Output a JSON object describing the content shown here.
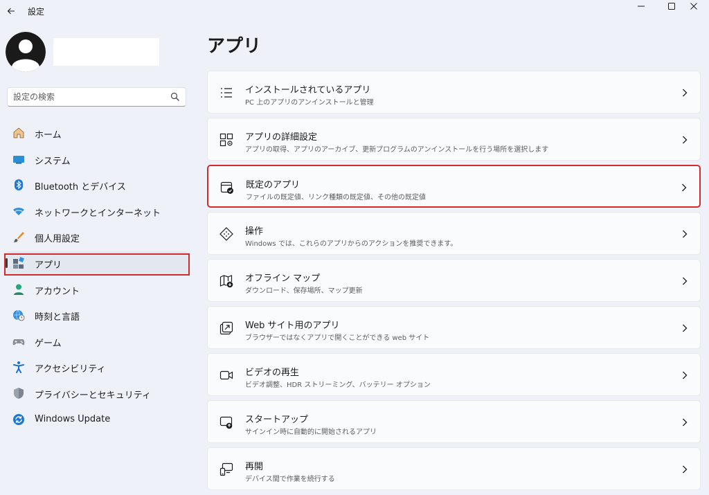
{
  "titlebar": {
    "title": "設定",
    "back_icon": "arrow-left-icon",
    "controls": [
      "minimize-icon",
      "maximize-icon",
      "close-icon"
    ]
  },
  "user": {
    "avatar_icon": "person-avatar-icon"
  },
  "search": {
    "placeholder": "設定の検索",
    "icon": "search-icon"
  },
  "sidebar": {
    "items": [
      {
        "label": "ホーム",
        "icon": "home-icon",
        "active": false
      },
      {
        "label": "システム",
        "icon": "monitor-icon",
        "active": false
      },
      {
        "label": "Bluetooth とデバイス",
        "icon": "bluetooth-icon",
        "active": false
      },
      {
        "label": "ネットワークとインターネット",
        "icon": "wifi-icon",
        "active": false
      },
      {
        "label": "個人用設定",
        "icon": "brush-icon",
        "active": false
      },
      {
        "label": "アプリ",
        "icon": "apps-icon",
        "active": true
      },
      {
        "label": "アカウント",
        "icon": "account-icon",
        "active": false
      },
      {
        "label": "時刻と言語",
        "icon": "globe-clock-icon",
        "active": false
      },
      {
        "label": "ゲーム",
        "icon": "gamepad-icon",
        "active": false
      },
      {
        "label": "アクセシビリティ",
        "icon": "accessibility-icon",
        "active": false
      },
      {
        "label": "プライバシーとセキュリティ",
        "icon": "shield-icon",
        "active": false
      },
      {
        "label": "Windows Update",
        "icon": "windows-update-icon",
        "active": false
      }
    ]
  },
  "main": {
    "title": "アプリ",
    "cards": [
      {
        "title": "インストールされているアプリ",
        "subtitle": "PC 上のアプリのアンインストールと管理",
        "icon": "list-icon"
      },
      {
        "title": "アプリの詳細設定",
        "subtitle": "アプリの取得、アプリのアーカイブ、更新プログラムのアンインストールを行う場所を選択します",
        "icon": "app-settings-icon"
      },
      {
        "title": "既定のアプリ",
        "subtitle": "ファイルの既定値、リンク種類の既定値、その他の既定値",
        "icon": "default-apps-icon"
      },
      {
        "title": "操作",
        "subtitle": "Windows では、これらのアプリからのアクションを推奨できます。",
        "icon": "actions-icon"
      },
      {
        "title": "オフライン マップ",
        "subtitle": "ダウンロード、保存場所、マップ更新",
        "icon": "offline-map-icon"
      },
      {
        "title": "Web サイト用のアプリ",
        "subtitle": "ブラウザーではなくアプリで開くことができる web サイト",
        "icon": "open-external-icon"
      },
      {
        "title": "ビデオの再生",
        "subtitle": "ビデオ調整、HDR ストリーミング、バッテリー オプション",
        "icon": "video-camera-icon"
      },
      {
        "title": "スタートアップ",
        "subtitle": "サインイン時に自動的に開始されるアプリ",
        "icon": "startup-icon"
      },
      {
        "title": "再開",
        "subtitle": "デバイス間で作業を続行する",
        "icon": "resume-devices-icon"
      }
    ]
  },
  "colors": {
    "background": "#eef2f8",
    "card": "#fafbfd",
    "highlight_box": "#d42a2a",
    "accent": "#0067c0"
  }
}
